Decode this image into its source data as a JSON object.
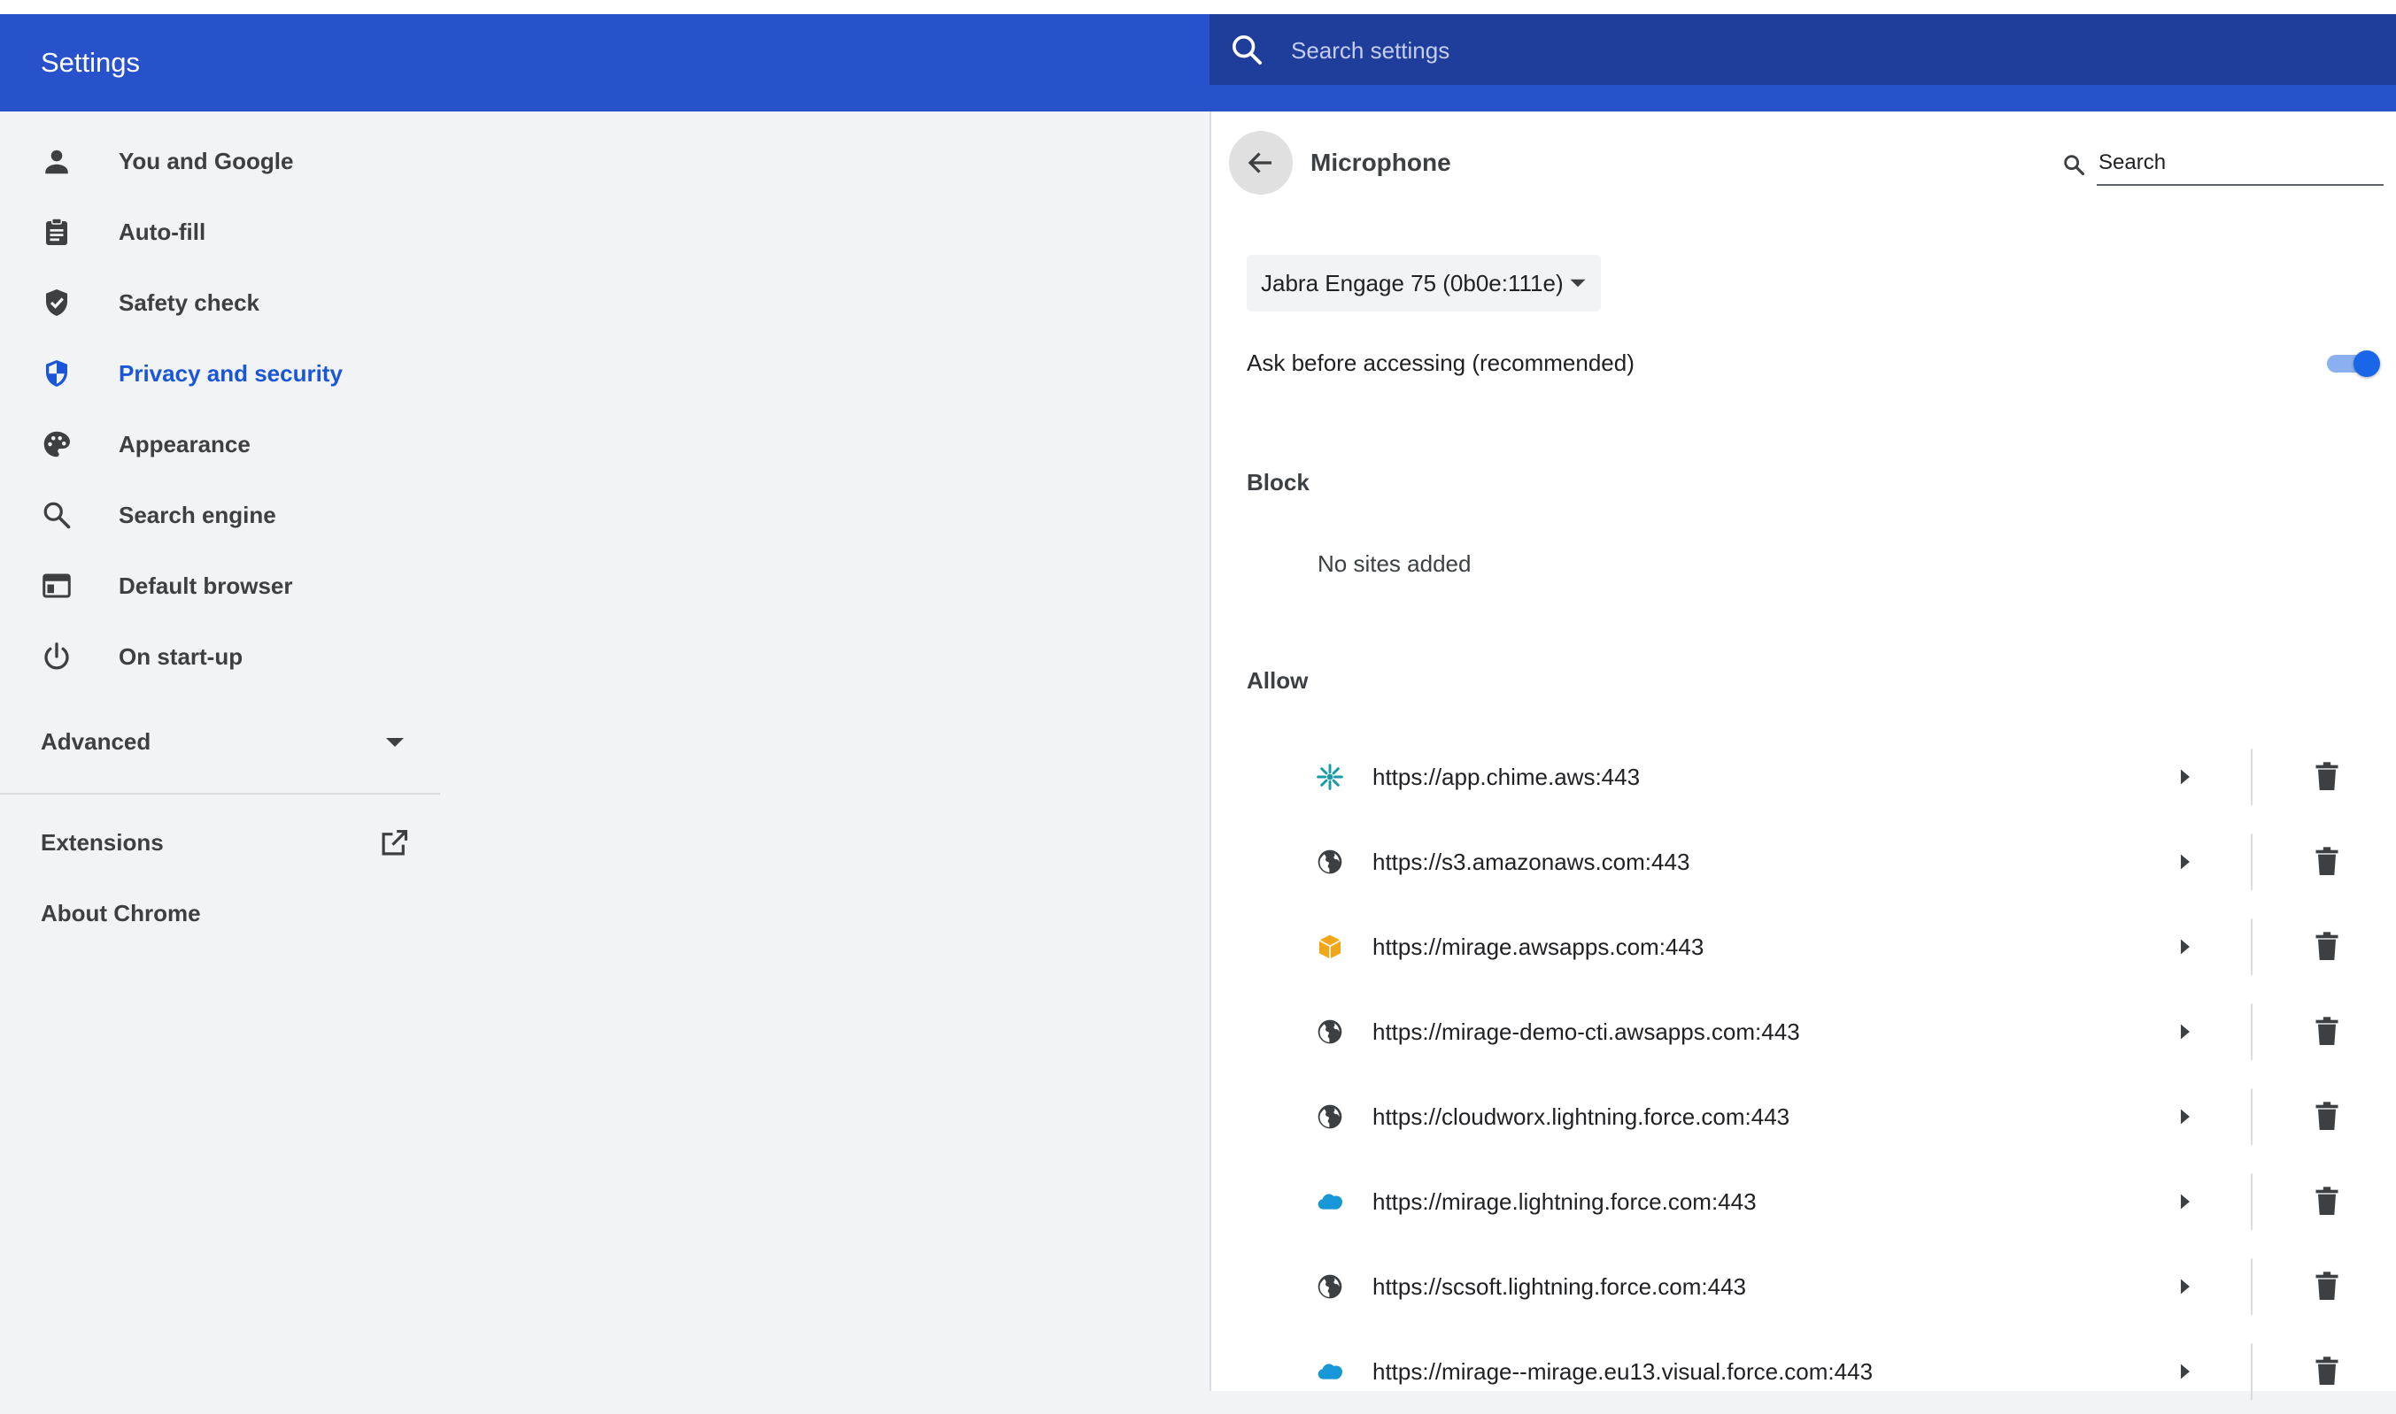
{
  "header": {
    "title": "Settings",
    "search_placeholder": "Search settings"
  },
  "sidebar": {
    "items": [
      {
        "label": "You and Google",
        "icon": "person-icon"
      },
      {
        "label": "Auto-fill",
        "icon": "clipboard-icon"
      },
      {
        "label": "Safety check",
        "icon": "shield-check-icon"
      },
      {
        "label": "Privacy and security",
        "icon": "privacy-shield-icon",
        "active": true
      },
      {
        "label": "Appearance",
        "icon": "palette-icon"
      },
      {
        "label": "Search engine",
        "icon": "search-icon"
      },
      {
        "label": "Default browser",
        "icon": "browser-window-icon"
      },
      {
        "label": "On start-up",
        "icon": "power-icon"
      }
    ],
    "advanced_label": "Advanced",
    "extensions_label": "Extensions",
    "about_label": "About Chrome"
  },
  "panel": {
    "title": "Microphone",
    "search_placeholder": "Search",
    "device": "Jabra Engage 75 (0b0e:111e)",
    "ask_label": "Ask before accessing (recommended)",
    "ask_enabled": true,
    "block_heading": "Block",
    "block_empty": "No sites added",
    "allow_heading": "Allow",
    "allow_sites": [
      {
        "url": "https://app.chime.aws:443",
        "icon": "chime-logo-icon"
      },
      {
        "url": "https://s3.amazonaws.com:443",
        "icon": "globe-icon"
      },
      {
        "url": "https://mirage.awsapps.com:443",
        "icon": "aws-box-icon"
      },
      {
        "url": "https://mirage-demo-cti.awsapps.com:443",
        "icon": "globe-icon"
      },
      {
        "url": "https://cloudworx.lightning.force.com:443",
        "icon": "globe-icon"
      },
      {
        "url": "https://mirage.lightning.force.com:443",
        "icon": "salesforce-cloud-icon"
      },
      {
        "url": "https://scsoft.lightning.force.com:443",
        "icon": "globe-icon"
      },
      {
        "url": "https://mirage--mirage.eu13.visual.force.com:443",
        "icon": "salesforce-cloud-icon"
      }
    ]
  },
  "colors": {
    "header_bg": "#2851cc",
    "search_bg": "#1f3e9b",
    "accent": "#1a56d6",
    "toggle_on": "#1a66e8"
  }
}
